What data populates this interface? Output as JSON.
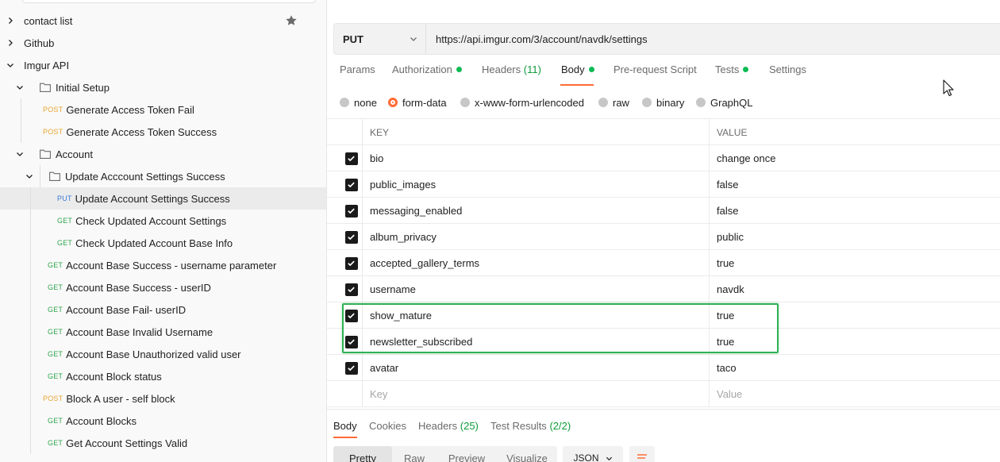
{
  "sidebar": {
    "items": [
      {
        "label": "contact list",
        "type": "collection",
        "expanded": false
      },
      {
        "label": "Github",
        "type": "collection",
        "expanded": false
      },
      {
        "label": "Imgur API",
        "type": "collection",
        "expanded": true
      },
      {
        "label": "Initial Setup",
        "type": "folder",
        "expanded": true
      },
      {
        "method": "POST",
        "label": "Generate Access Token Fail"
      },
      {
        "method": "POST",
        "label": "Generate Access Token Success"
      },
      {
        "label": "Account",
        "type": "folder",
        "expanded": true
      },
      {
        "label": "Update Acccount Settings Success",
        "type": "folder",
        "expanded": true
      },
      {
        "method": "PUT",
        "label": "Update Account Settings Success",
        "active": true
      },
      {
        "method": "GET",
        "label": "Check Updated Account Settings"
      },
      {
        "method": "GET",
        "label": "Check Updated Account Base Info"
      },
      {
        "method": "GET",
        "label": "Account Base Success - username parameter"
      },
      {
        "method": "GET",
        "label": "Account Base Success - userID"
      },
      {
        "method": "GET",
        "label": "Account Base Fail- userID"
      },
      {
        "method": "GET",
        "label": "Account Base Invalid Username"
      },
      {
        "method": "GET",
        "label": "Account Base Unauthorized valid user"
      },
      {
        "method": "GET",
        "label": "Account Block status"
      },
      {
        "method": "POST",
        "label": "Block A user - self block"
      },
      {
        "method": "GET",
        "label": "Account Blocks"
      },
      {
        "method": "GET",
        "label": "Get Account Settings Valid"
      }
    ]
  },
  "request": {
    "method": "PUT",
    "url": "https://api.imgur.com/3/account/navdk/settings",
    "tabs": [
      {
        "label": "Params"
      },
      {
        "label": "Authorization",
        "dot": true
      },
      {
        "label": "Headers",
        "count": "(11)"
      },
      {
        "label": "Body",
        "dot": true,
        "active": true
      },
      {
        "label": "Pre-request Script"
      },
      {
        "label": "Tests",
        "dot": true
      },
      {
        "label": "Settings"
      }
    ],
    "body_types": [
      {
        "label": "none"
      },
      {
        "label": "form-data",
        "selected": true
      },
      {
        "label": "x-www-form-urlencoded"
      },
      {
        "label": "raw"
      },
      {
        "label": "binary"
      },
      {
        "label": "GraphQL"
      }
    ],
    "table": {
      "key_header": "KEY",
      "value_header": "VALUE",
      "rows": [
        {
          "key": "bio",
          "value": "change once",
          "checked": true
        },
        {
          "key": "public_images",
          "value": "false",
          "checked": true
        },
        {
          "key": "messaging_enabled",
          "value": "false",
          "checked": true
        },
        {
          "key": "album_privacy",
          "value": "public",
          "checked": true
        },
        {
          "key": "accepted_gallery_terms",
          "value": "true",
          "checked": true
        },
        {
          "key": "username",
          "value": "navdk",
          "checked": true
        },
        {
          "key": "show_mature",
          "value": "true",
          "checked": true
        },
        {
          "key": "newsletter_subscribed",
          "value": "true",
          "checked": true
        },
        {
          "key": "avatar",
          "value": "taco",
          "checked": true
        }
      ],
      "key_placeholder": "Key",
      "value_placeholder": "Value"
    }
  },
  "response": {
    "tabs": [
      {
        "label": "Body",
        "active": true
      },
      {
        "label": "Cookies"
      },
      {
        "label": "Headers",
        "count": "(25)"
      },
      {
        "label": "Test Results",
        "count": "(2/2)"
      }
    ],
    "views": [
      "Pretty",
      "Raw",
      "Preview",
      "Visualize"
    ],
    "active_view": "Pretty",
    "format": "JSON"
  },
  "colors": {
    "accent": "#ff6c37",
    "post": "#e8a532",
    "get": "#2fa54d",
    "put": "#3a7ad9",
    "highlight": "#2fb155",
    "count": "#0b9b3a"
  }
}
